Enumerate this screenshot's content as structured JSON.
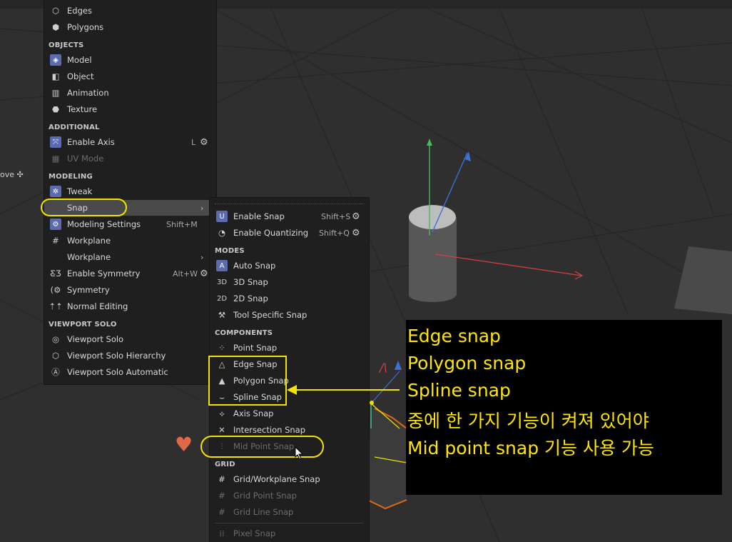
{
  "viewport": {
    "move_label": "ove ✣"
  },
  "main_menu": {
    "top_items": [
      {
        "label": "Edges",
        "icon": "edges-icon"
      },
      {
        "label": "Polygons",
        "icon": "polygons-icon"
      }
    ],
    "sections": {
      "objects": "OBJECTS",
      "additional": "ADDITIONAL",
      "modeling": "MODELING",
      "viewport_solo": "VIEWPORT SOLO"
    },
    "objects_items": [
      {
        "label": "Model"
      },
      {
        "label": "Object"
      },
      {
        "label": "Animation"
      },
      {
        "label": "Texture"
      }
    ],
    "additional_items": [
      {
        "label": "Enable Axis",
        "shortcut": "L"
      },
      {
        "label": "UV Mode"
      }
    ],
    "modeling_items": [
      {
        "label": "Tweak"
      },
      {
        "label": "Snap"
      },
      {
        "label": "Modeling Settings",
        "shortcut": "Shift+M"
      },
      {
        "label": "Workplane"
      },
      {
        "label": "Workplane"
      },
      {
        "label": "Enable Symmetry",
        "shortcut": "Alt+W"
      },
      {
        "label": "Symmetry"
      },
      {
        "label": "Normal Editing"
      }
    ],
    "viewport_solo_items": [
      {
        "label": "Viewport Solo"
      },
      {
        "label": "Viewport Solo Hierarchy"
      },
      {
        "label": "Viewport Solo Automatic"
      }
    ]
  },
  "snap_menu": {
    "top_items": [
      {
        "label": "Enable Snap",
        "shortcut": "Shift+S"
      },
      {
        "label": "Enable Quantizing",
        "shortcut": "Shift+Q"
      }
    ],
    "sections": {
      "modes": "MODES",
      "components": "COMPONENTS",
      "grid": "GRID"
    },
    "modes_items": [
      {
        "label": "Auto Snap"
      },
      {
        "label": "3D Snap"
      },
      {
        "label": "2D Snap"
      },
      {
        "label": "Tool Specific Snap"
      }
    ],
    "components_items": [
      {
        "label": "Point Snap"
      },
      {
        "label": "Edge Snap"
      },
      {
        "label": "Polygon Snap"
      },
      {
        "label": "Spline Snap"
      },
      {
        "label": "Axis Snap"
      },
      {
        "label": "Intersection Snap"
      },
      {
        "label": "Mid Point Snap"
      }
    ],
    "grid_items": [
      {
        "label": "Grid/Workplane Snap"
      },
      {
        "label": "Grid Point Snap"
      },
      {
        "label": "Grid Line Snap"
      }
    ],
    "extra_items": [
      {
        "label": "Pixel Snap"
      }
    ]
  },
  "annotation": {
    "lines": [
      "Edge snap",
      "Polygon snap",
      "Spline snap",
      "중에 한 가지 기능이 켜져 있어야",
      "Mid point snap 기능 사용 가능"
    ]
  },
  "colors": {
    "highlight": "#f2e400",
    "accent": "#5c6bb0",
    "heart": "#e0684a"
  }
}
